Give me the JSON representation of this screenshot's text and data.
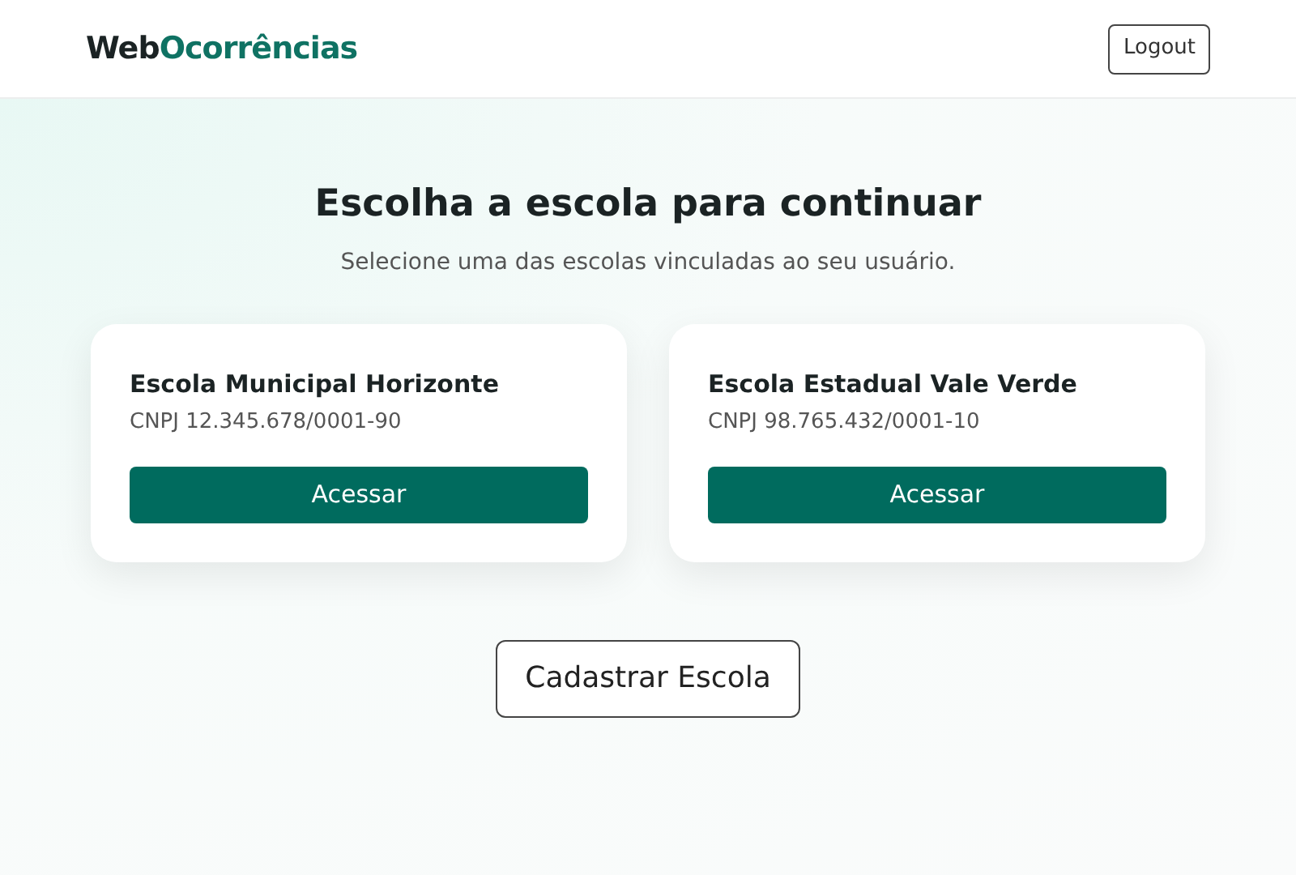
{
  "header": {
    "logo": {
      "prefix": "Web",
      "accent": "Ocorrências"
    },
    "logout_button": "Logout"
  },
  "title": "Escolha a escola para continuar",
  "subtitle": "Selecione uma das escolas vinculadas ao seu usuário.",
  "schools": [
    {
      "name": "Escola Municipal Horizonte",
      "cnpj": "CNPJ 12.345.678/0001-90",
      "button": "Acessar"
    },
    {
      "name": "Escola Estadual Vale Verde",
      "cnpj": "CNPJ 98.765.432/0001-10",
      "button": "Acessar"
    }
  ],
  "register_button": "Cadastrar Escola"
}
